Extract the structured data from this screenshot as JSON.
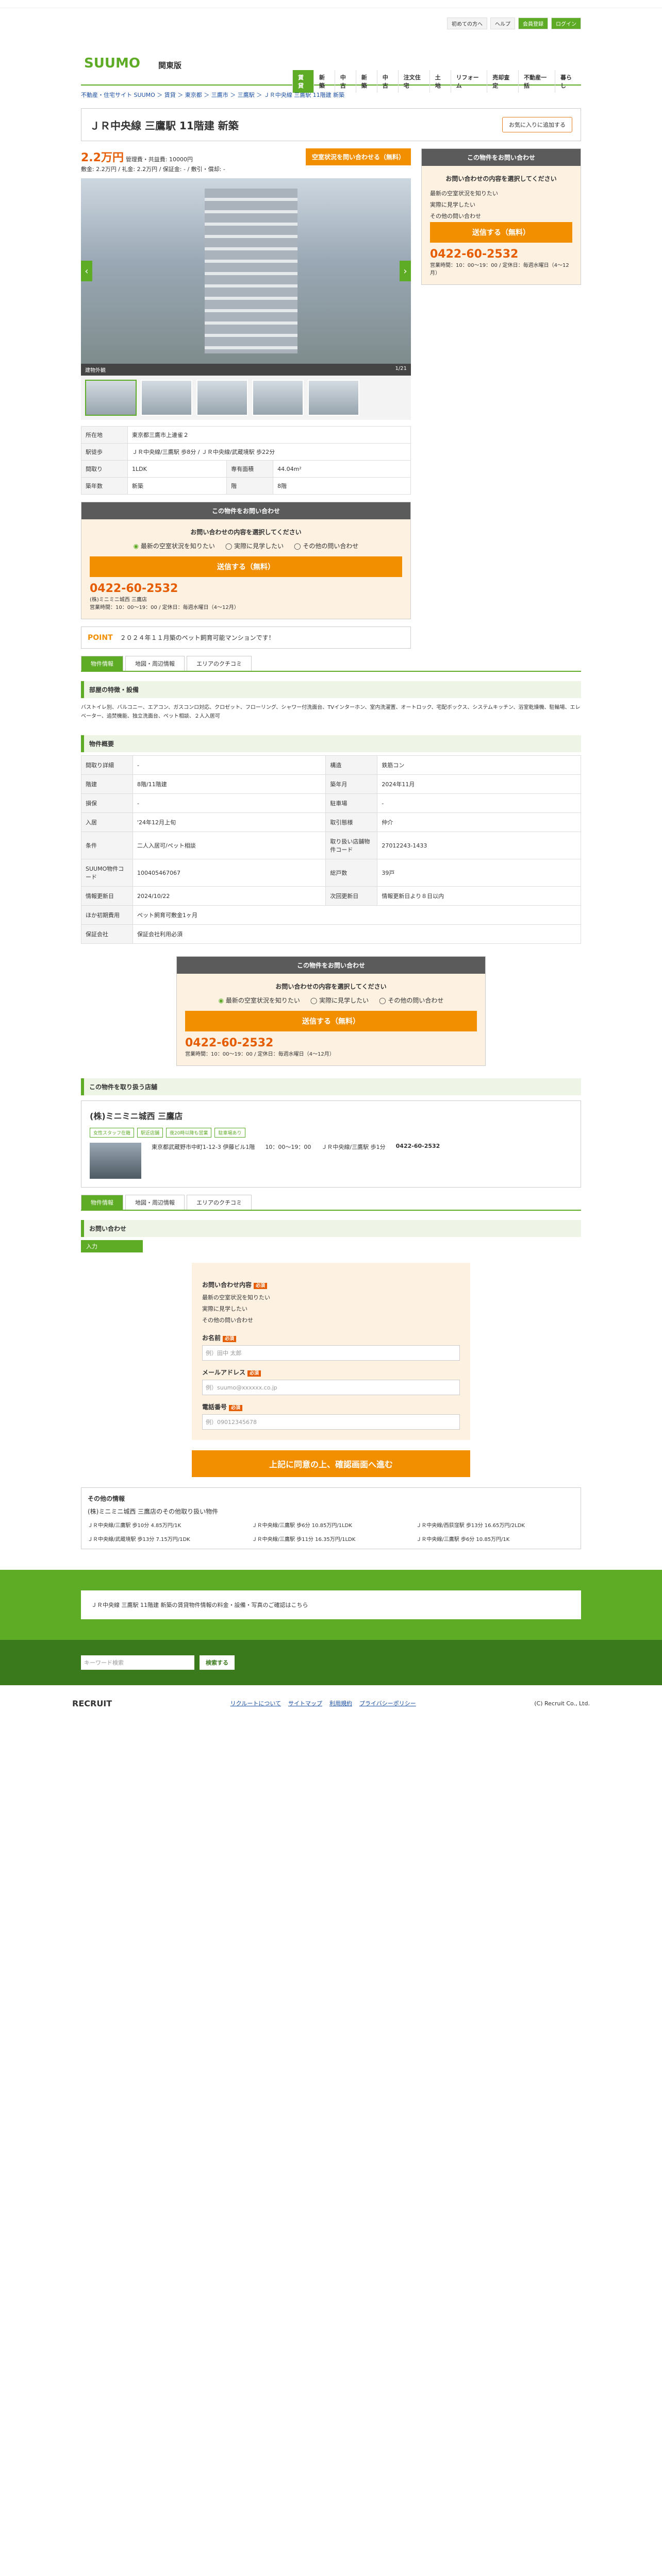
{
  "header": {
    "logo": "SUUMO",
    "region": "関東版",
    "links": [
      "初めての方へ",
      "ヘルプ",
      "会員登録",
      "ログイン"
    ],
    "nav": [
      "賃貸",
      "新築",
      "中古",
      "新築",
      "中古",
      "注文住宅",
      "土地",
      "リフォーム",
      "売却査定",
      "不動産一括",
      "暮らし"
    ]
  },
  "breadcrumb": "不動産・住宅サイト SUUMO ＞ 賃貸 ＞ 東京都 ＞ 三鷹市 ＞ 三鷹駅 ＞ ＪＲ中央線 三鷹駅 11階建 新築",
  "property": {
    "title": "ＪＲ中央線 三鷹駅 11階建 新築",
    "fav": "お気に入りに追加する",
    "price": "2.2万円",
    "price_sub": "管理費・共益費: 10000円",
    "price_detail": "敷金: 2.2万円 / 礼金: 2.2万円 / 保証金: - / 敷引・償却: -",
    "cta": "空室状況を問い合わせる（無料）",
    "photo_label": "建物外観",
    "photo_count": "1/21"
  },
  "info": [
    {
      "k": "所在地",
      "v": "東京都三鷹市上連雀２"
    },
    {
      "k": "駅徒歩",
      "v": "ＪＲ中央線/三鷹駅 歩8分 / ＪＲ中央線/武蔵境駅 歩22分"
    },
    {
      "k": "間取り",
      "v": "1LDK"
    },
    {
      "k": "専有面積",
      "v": "44.04m²"
    },
    {
      "k": "築年数",
      "v": "新築"
    },
    {
      "k": "階",
      "v": "8階"
    }
  ],
  "inquiry": {
    "head": "この物件をお問い合わせ",
    "question": "お問い合わせの内容を選択してください",
    "options": [
      "最新の空室状況を知りたい",
      "実際に見学したい",
      "その他の問い合わせ"
    ],
    "send": "送信する（無料）",
    "tel": "0422-60-2532",
    "agent": "(株)ミニミニ城西 三鷹店",
    "hours": "営業時間：10：00～19：00 / 定休日：毎週水曜日（4～12月）"
  },
  "point": {
    "badge": "POINT",
    "text": "２０２４年１１月築のペット飼育可能マンションです！"
  },
  "tabs": [
    "物件情報",
    "地図・周辺情報",
    "エリアのクチコミ"
  ],
  "features_title": "部屋の特徴・設備",
  "features": "バストイレ別、バルコニー、エアコン、ガスコンロ対応、クロゼット、フローリング、シャワー付洗面台、TVインターホン、室内洗濯置、オートロック、宅配ボックス、システムキッチン、浴室乾燥機、駐輪場、エレベーター、追焚機能、独立洗面台、ペット相談、２人入居可",
  "overview_title": "物件概要",
  "overview": [
    {
      "k": "間取り詳細",
      "v": "-",
      "k2": "構造",
      "v2": "鉄筋コン"
    },
    {
      "k": "階建",
      "v": "8階/11階建",
      "k2": "築年月",
      "v2": "2024年11月"
    },
    {
      "k": "損保",
      "v": "-",
      "k2": "駐車場",
      "v2": "-"
    },
    {
      "k": "入居",
      "v": "'24年12月上旬",
      "k2": "取引態様",
      "v2": "仲介"
    },
    {
      "k": "条件",
      "v": "二人入居可/ペット相談",
      "k2": "取り扱い店舗物件コード",
      "v2": "27012243-1433"
    },
    {
      "k": "SUUMO物件コード",
      "v": "100405467067",
      "k2": "総戸数",
      "v2": "39戸"
    },
    {
      "k": "情報更新日",
      "v": "2024/10/22",
      "k2": "次回更新日",
      "v2": "情報更新日より８日以内"
    },
    {
      "k": "ほか初期費用",
      "v": "ペット飼育可敷金1ヶ月",
      "k2": "",
      "v2": ""
    },
    {
      "k": "保証会社",
      "v": "保証会社利用必須",
      "k2": "",
      "v2": ""
    }
  ],
  "agent_section": {
    "title": "この物件を取り扱う店舗",
    "name": "(株)ミニミニ城西 三鷹店",
    "tags": [
      "女性スタッフ在籍",
      "駅近店舗",
      "夜20時以降も営業",
      "駐車場あり"
    ],
    "address": "東京都武蔵野市中町1-12-3 伊藤ビル1階",
    "hours": "10：00～19：00",
    "station": "ＪＲ中央線/三鷹駅 歩1分",
    "tel": "0422-60-2532"
  },
  "form": {
    "title": "お問い合わせ",
    "step": "入力",
    "content_label": "お問い合わせ内容",
    "name_label": "お名前",
    "name_ph": "例）田中 太郎",
    "email_label": "メールアドレス",
    "email_ph": "例）suumo@xxxxxx.co.jp",
    "phone_label": "電話番号",
    "phone_ph": "例）09012345678",
    "submit": "上記に同意の上、確認画面へ進む"
  },
  "other": {
    "title": "その他の情報",
    "subtitle": "(株)ミニミニ城西 三鷹店のその他取り扱い物件",
    "items": [
      "ＪＲ中央線/三鷹駅 歩10分 4.85万円/1K",
      "ＪＲ中央線/三鷹駅 歩6分 10.85万円/1LDK",
      "ＪＲ中央線/西荻窪駅 歩13分 16.65万円/2LDK",
      "ＪＲ中央線/武蔵境駅 歩13分 7.15万円/1DK",
      "ＪＲ中央線/三鷹駅 歩11分 16.35万円/1LDK",
      "ＪＲ中央線/三鷹駅 歩6分 10.85万円/1K"
    ]
  },
  "footer": {
    "text": "ＪＲ中央線 三鷹駅 11階建 新築の賃貸物件情報の料金・設備・写真のご確認はこちら",
    "search_ph": "キーワード検索",
    "search_btn": "検索する",
    "links": [
      "リクルートについて",
      "サイトマップ",
      "利用規約",
      "プライバシーポリシー"
    ],
    "copyright": "(C) Recruit Co., Ltd.",
    "brand": "RECRUIT"
  }
}
